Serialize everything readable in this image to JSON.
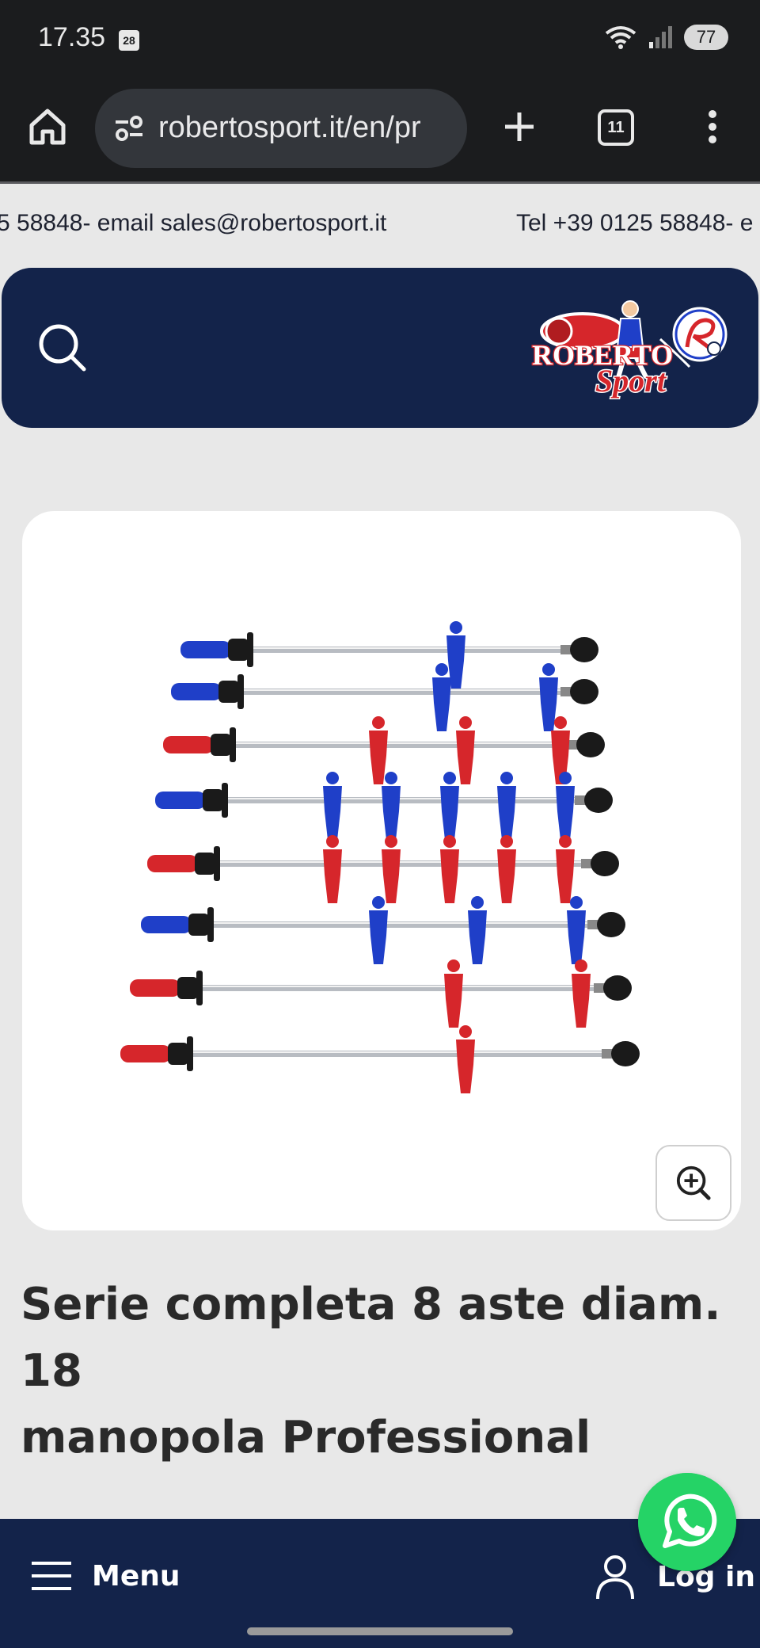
{
  "status_bar": {
    "time": "17.35",
    "calendar_day": "28",
    "battery": "77"
  },
  "browser": {
    "url": "robertosport.it/en/pr",
    "tab_count": "11"
  },
  "ticker": {
    "segment_1": "5 58848- email sales@robertosport.it",
    "segment_2": "Tel +39 0125 58848- e"
  },
  "header": {
    "logo_text_main": "ROBERTO",
    "logo_text_sub": "Sport"
  },
  "product": {
    "title_line_1": "Serie completa 8 aste diam. 18",
    "title_line_2": "manopola Professional"
  },
  "bottom_nav": {
    "menu_label": "Menu",
    "login_label": "Log in"
  },
  "colors": {
    "navy": "#13234a",
    "whatsapp_green": "#25d366",
    "blue_player": "#1f3fc8",
    "red_player": "#d6262b"
  }
}
